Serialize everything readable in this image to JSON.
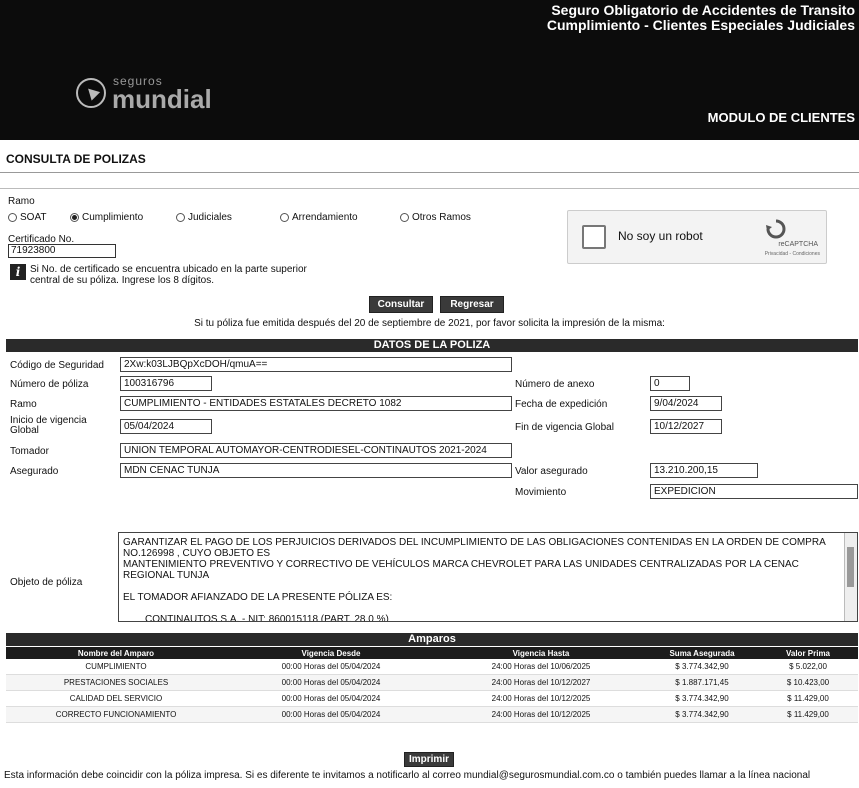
{
  "header": {
    "title_line1": "Seguro Obligatorio de Accidentes de Transito",
    "title_line2": "Cumplimiento - Clientes Especiales Judiciales",
    "logo_small": "seguros",
    "logo_big": "mundial",
    "module": "MODULO DE CLIENTES"
  },
  "page_title": "CONSULTA DE POLIZAS",
  "form": {
    "ramo_label": "Ramo",
    "options": [
      {
        "label": "SOAT",
        "selected": false
      },
      {
        "label": "Cumplimiento",
        "selected": true
      },
      {
        "label": "Judiciales",
        "selected": false
      },
      {
        "label": "Arrendamiento",
        "selected": false
      },
      {
        "label": "Otros Ramos",
        "selected": false
      }
    ],
    "cert_label": "Certificado No.",
    "cert_value": "71923800",
    "info_text": "Si No. de certificado se encuentra ubicado en la parte superior central de su póliza. Ingrese los 8 dígitos."
  },
  "captcha": {
    "text": "No soy un robot",
    "brand": "reCAPTCHA",
    "sub": "Privacidad - Condiciones"
  },
  "buttons": {
    "consultar": "Consultar",
    "regresar": "Regresar",
    "imprimir": "Imprimir"
  },
  "note": "Si tu póliza fue emitida después del 20 de septiembre de 2021, por favor solicita la impresión de la misma:",
  "datos": {
    "title": "DATOS DE LA POLIZA",
    "codigo_label": "Código de Seguridad",
    "codigo": "2Xw:k03LJBQpXcDOH/qmuA==",
    "numero_label": "Número de póliza",
    "numero": "100316796",
    "anexo_label": "Número de anexo",
    "anexo": "0",
    "ramo_label": "Ramo",
    "ramo": "CUMPLIMIENTO - ENTIDADES ESTATALES DECRETO 1082",
    "expedicion_label": "Fecha de expedición",
    "expedicion": "9/04/2024",
    "inicio_label_1": "Inicio de vigencia",
    "inicio_label_2": "Global",
    "inicio": "05/04/2024",
    "fin_label": "Fin de vigencia Global",
    "fin": "10/12/2027",
    "tomador_label": "Tomador",
    "tomador": "UNION TEMPORAL AUTOMAYOR-CENTRODIESEL-CONTINAUTOS 2021-2024",
    "asegurado_label": "Asegurado",
    "asegurado": "MDN CENAC TUNJA",
    "valor_label": "Valor asegurado",
    "valor": "13.210.200,15",
    "movimiento_label": "Movimiento",
    "movimiento": "EXPEDICION",
    "objeto_label": "Objeto de póliza",
    "objeto_p1": "GARANTIZAR EL PAGO DE LOS PERJUICIOS DERIVADOS DEL INCUMPLIMIENTO DE LAS OBLIGACIONES CONTENIDAS EN LA ORDEN DE COMPRA NO.126998 , CUYO OBJETO ES",
    "objeto_p2": "MANTENIMIENTO PREVENTIVO Y CORRECTIVO DE VEHÍCULOS MARCA CHEVROLET PARA LAS UNIDADES CENTRALIZADAS POR LA CENAC REGIONAL TUNJA",
    "objeto_p3": "EL TOMADOR AFIANZADO DE LA PRESENTE PÓLIZA ES:",
    "objeto_p4": "CONTINAUTOS S.A. - NIT: 860015118 (PART. 28.0 %)"
  },
  "amparos": {
    "title": "Amparos",
    "headers": [
      "Nombre del Amparo",
      "Vigencia Desde",
      "Vigencia Hasta",
      "Suma Asegurada",
      "Valor Prima"
    ],
    "rows": [
      [
        "CUMPLIMIENTO",
        "00:00 Horas del 05/04/2024",
        "24:00 Horas del 10/06/2025",
        "$ 3.774.342,90",
        "$ 5.022,00"
      ],
      [
        "PRESTACIONES SOCIALES",
        "00:00 Horas del 05/04/2024",
        "24:00 Horas del 10/12/2027",
        "$ 1.887.171,45",
        "$ 10.423,00"
      ],
      [
        "CALIDAD DEL SERVICIO",
        "00:00 Horas del 05/04/2024",
        "24:00 Horas del 10/12/2025",
        "$ 3.774.342,90",
        "$ 11.429,00"
      ],
      [
        "CORRECTO FUNCIONAMIENTO",
        "00:00 Horas del 05/04/2024",
        "24:00 Horas del 10/12/2025",
        "$ 3.774.342,90",
        "$ 11.429,00"
      ]
    ]
  },
  "footer": "Esta información debe coincidir con la póliza impresa. Si es diferente te invitamos a notificarlo al correo mundial@segurosmundial.com.co o también puedes llamar a la línea nacional"
}
